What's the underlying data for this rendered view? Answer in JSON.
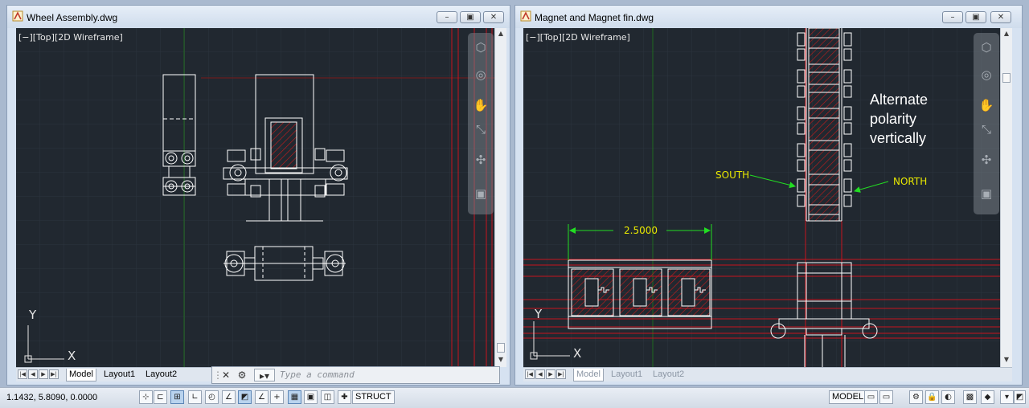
{
  "left_window": {
    "title": "Wheel Assembly.dwg",
    "viewport_label": "[−][Top][2D Wireframe]",
    "tabs": [
      "Model",
      "Layout1",
      "Layout2"
    ],
    "ucs_x": "X",
    "ucs_y": "Y"
  },
  "right_window": {
    "title": "Magnet and Magnet fin.dwg",
    "viewport_label": "[−][Top][2D Wireframe]",
    "tabs": [
      "Model",
      "Layout1",
      "Layout2"
    ],
    "ucs_x": "X",
    "ucs_y": "Y",
    "annotations": {
      "note_line1": "Alternate",
      "note_line2": "polarity",
      "note_line3": "vertically",
      "south": "SOUTH",
      "north": "NORTH",
      "dimension": "2.5000"
    }
  },
  "window_buttons": {
    "minimize": "–",
    "restore": "▣",
    "close": "✕"
  },
  "command_line": {
    "placeholder": "Type a command",
    "close_icon": "✕",
    "settings_icon": "🔧"
  },
  "status_bar": {
    "coordinates": "1.1432, 5.8090, 0.0000",
    "struct_label": "STRUCT",
    "model_label": "MODEL"
  },
  "colors": {
    "drawing_background": "#212830",
    "grid_line": "#2c343e",
    "geometry_white": "#ffffff",
    "red_lines": "#c8141e",
    "hatch_red": "#c21c1c",
    "dimension_green": "#22dd22",
    "annotation_yellow": "#e8e800",
    "axis_green": "#1f6a1f"
  }
}
